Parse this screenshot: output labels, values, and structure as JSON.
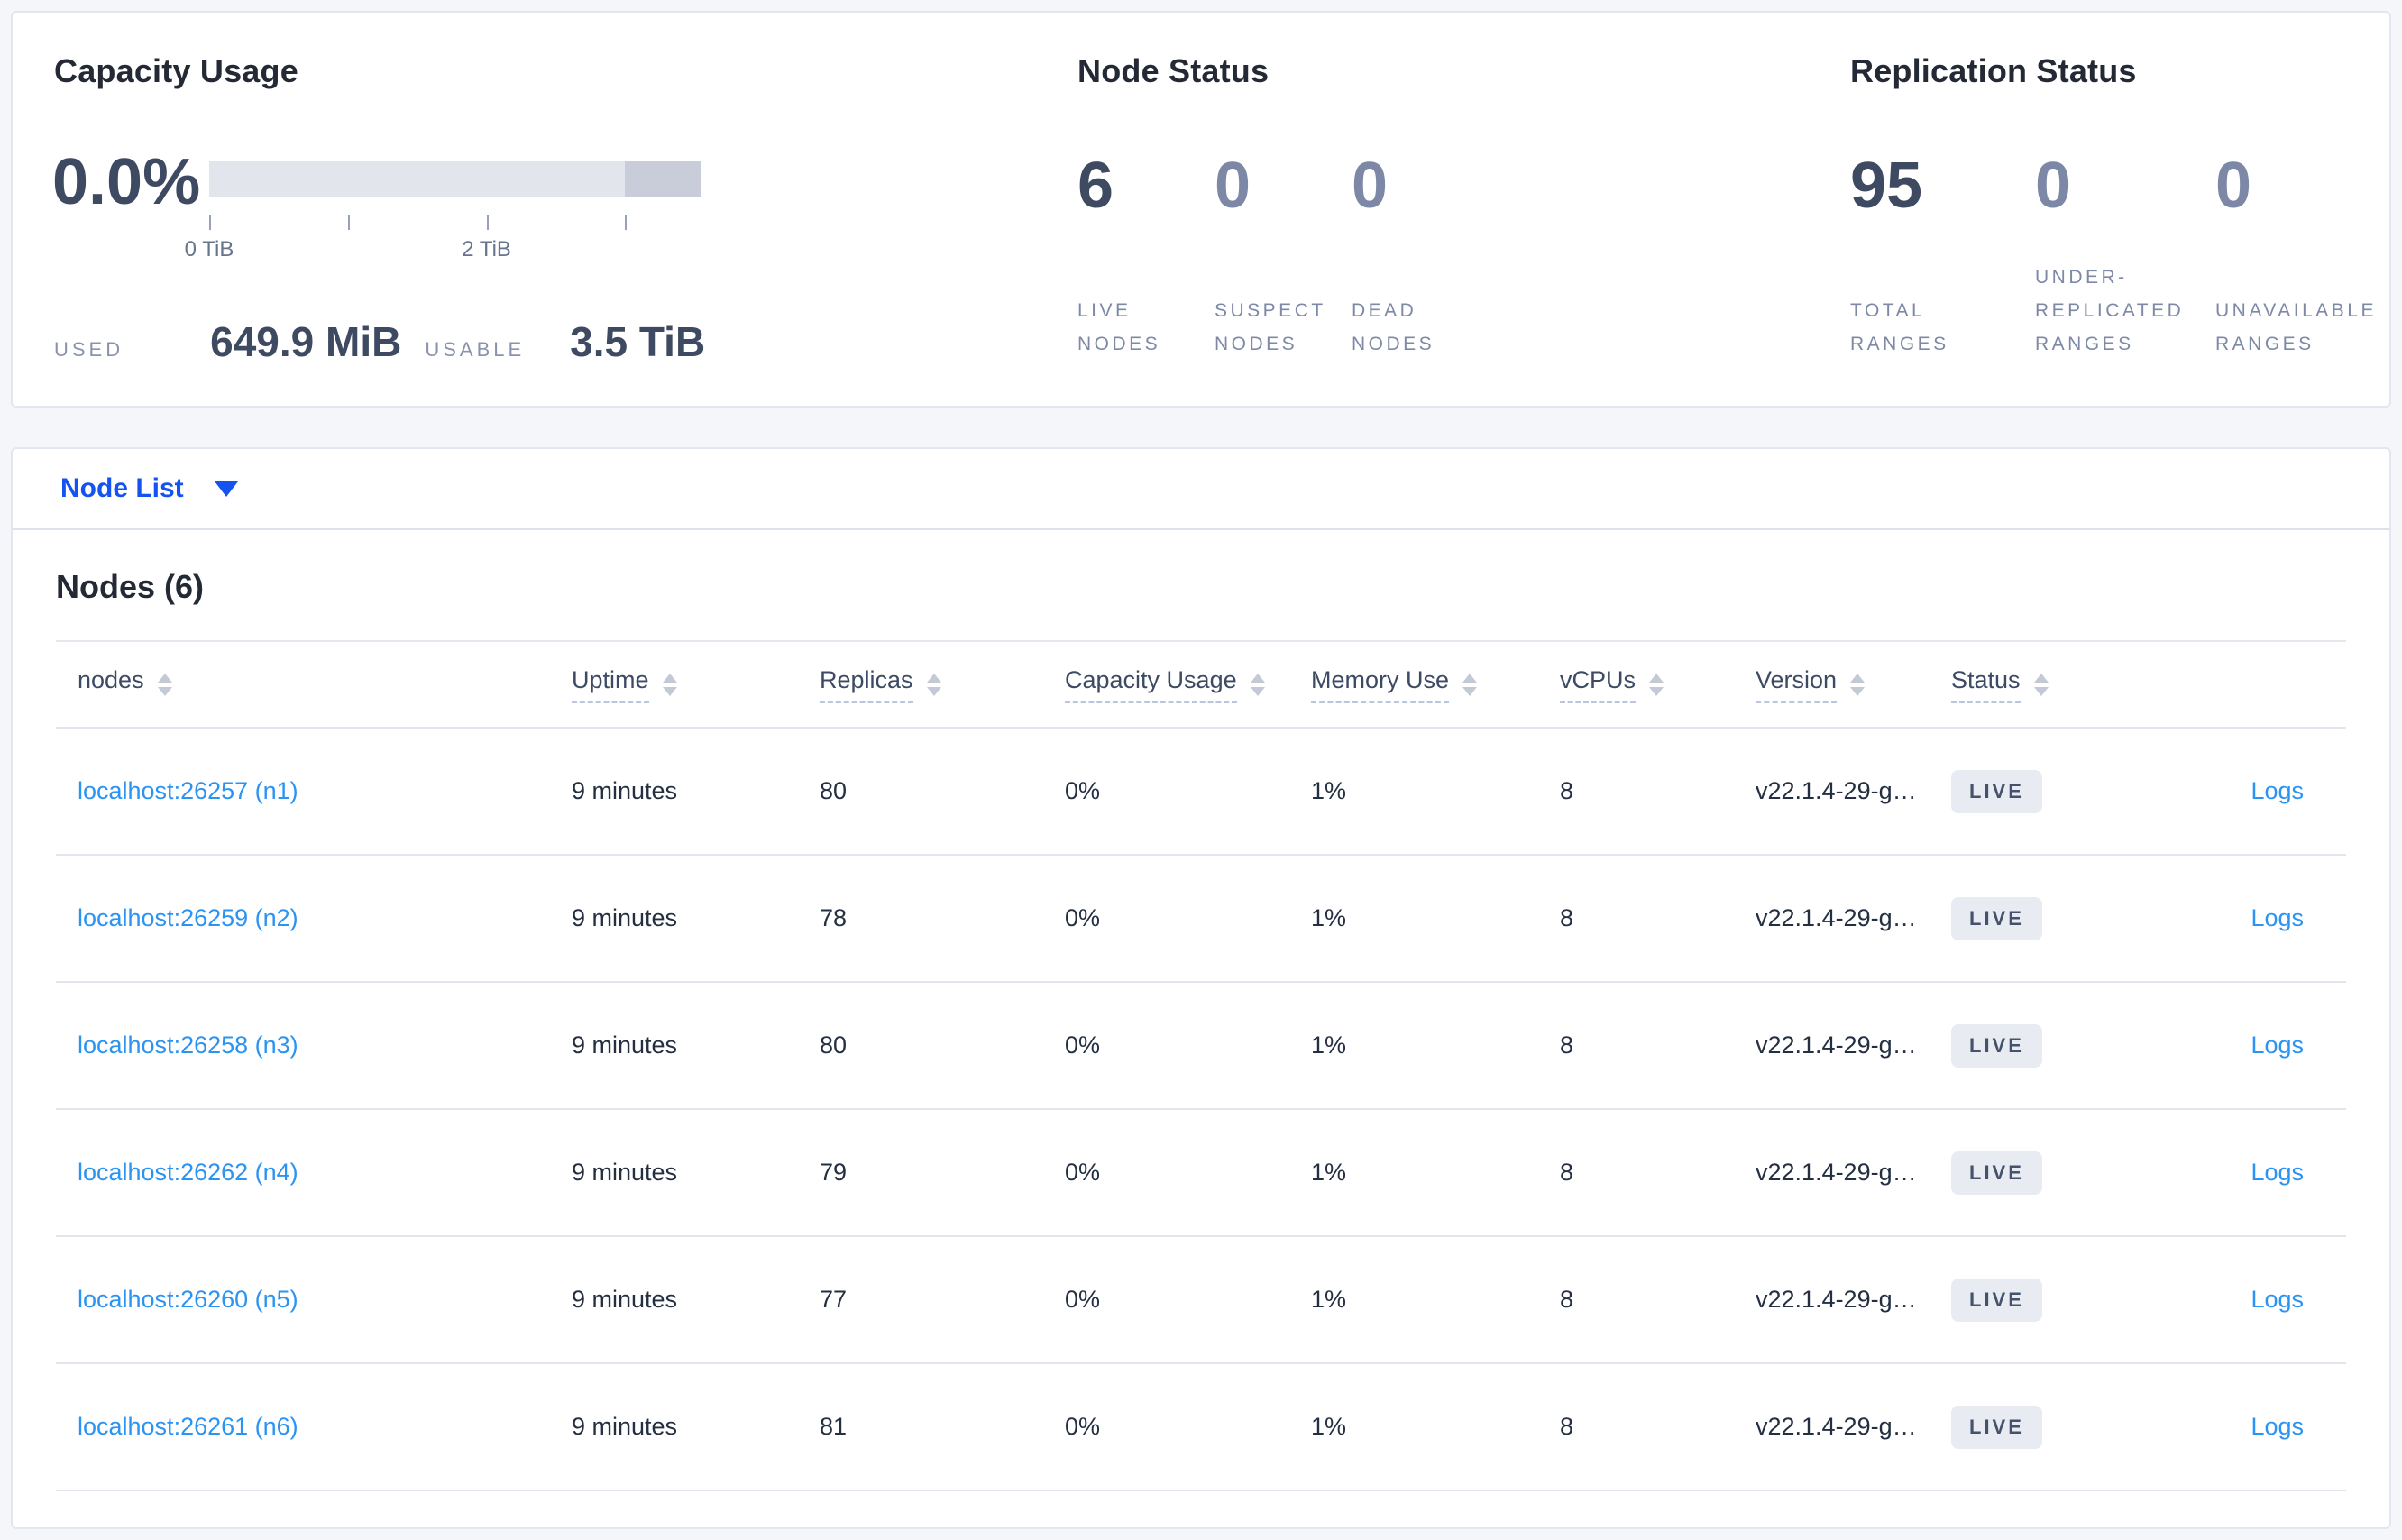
{
  "colors": {
    "selector_blue": "#1553f0",
    "link_blue": "#2b93f2",
    "badge_bg": "#e8ecf2",
    "badge_text": "#44526b",
    "bar_track": "#e3e5ec",
    "bar_highlight": "#c9cdd9"
  },
  "summary": {
    "capacity": {
      "title": "Capacity Usage",
      "percent": "0.0%",
      "used_label": "USED",
      "used_value": "649.9 MiB",
      "usable_label": "USABLE",
      "usable_value": "3.5 TiB",
      "axis_tick_labels": [
        "0 TiB",
        "2 TiB"
      ],
      "bar": {
        "extent_tib": 3.55,
        "tick_values_tib": [
          0,
          1,
          2,
          3
        ],
        "labeled_tick_values_tib": [
          0,
          2
        ],
        "used_fraction": 0.0,
        "highlight_from_tib": 3.0
      }
    },
    "node_status": {
      "title": "Node Status",
      "stats": [
        {
          "value": "6",
          "label": "LIVE NODES"
        },
        {
          "value": "0",
          "label": "SUSPECT NODES"
        },
        {
          "value": "0",
          "label": "DEAD NODES"
        }
      ]
    },
    "replication_status": {
      "title": "Replication Status",
      "stats": [
        {
          "value": "95",
          "label": "TOTAL RANGES"
        },
        {
          "value": "0",
          "label": "UNDER-REPLICATED RANGES"
        },
        {
          "value": "0",
          "label": "UNAVAILABLE RANGES"
        }
      ]
    }
  },
  "view_selector": {
    "label": "Node List",
    "icon": "caret-down-icon"
  },
  "nodes_table": {
    "title": "Nodes (6)",
    "columns": [
      {
        "label": "nodes",
        "sortable": true,
        "tooltip_underline": false
      },
      {
        "label": "Uptime",
        "sortable": true,
        "tooltip_underline": true
      },
      {
        "label": "Replicas",
        "sortable": true,
        "tooltip_underline": true
      },
      {
        "label": "Capacity Usage",
        "sortable": true,
        "tooltip_underline": true
      },
      {
        "label": "Memory Use",
        "sortable": true,
        "tooltip_underline": true
      },
      {
        "label": "vCPUs",
        "sortable": true,
        "tooltip_underline": true
      },
      {
        "label": "Version",
        "sortable": true,
        "tooltip_underline": true
      },
      {
        "label": "Status",
        "sortable": true,
        "tooltip_underline": true
      },
      {
        "label": "",
        "sortable": false,
        "tooltip_underline": false
      }
    ],
    "rows": [
      {
        "host": "localhost:26257 (n1)",
        "uptime": "9 minutes",
        "replicas": "80",
        "capacity_usage": "0%",
        "memory_use": "1%",
        "vcpus": "8",
        "version": "v22.1.4-29-g…",
        "status": "LIVE",
        "logs_label": "Logs"
      },
      {
        "host": "localhost:26259 (n2)",
        "uptime": "9 minutes",
        "replicas": "78",
        "capacity_usage": "0%",
        "memory_use": "1%",
        "vcpus": "8",
        "version": "v22.1.4-29-g…",
        "status": "LIVE",
        "logs_label": "Logs"
      },
      {
        "host": "localhost:26258 (n3)",
        "uptime": "9 minutes",
        "replicas": "80",
        "capacity_usage": "0%",
        "memory_use": "1%",
        "vcpus": "8",
        "version": "v22.1.4-29-g…",
        "status": "LIVE",
        "logs_label": "Logs"
      },
      {
        "host": "localhost:26262 (n4)",
        "uptime": "9 minutes",
        "replicas": "79",
        "capacity_usage": "0%",
        "memory_use": "1%",
        "vcpus": "8",
        "version": "v22.1.4-29-g…",
        "status": "LIVE",
        "logs_label": "Logs"
      },
      {
        "host": "localhost:26260 (n5)",
        "uptime": "9 minutes",
        "replicas": "77",
        "capacity_usage": "0%",
        "memory_use": "1%",
        "vcpus": "8",
        "version": "v22.1.4-29-g…",
        "status": "LIVE",
        "logs_label": "Logs"
      },
      {
        "host": "localhost:26261 (n6)",
        "uptime": "9 minutes",
        "replicas": "81",
        "capacity_usage": "0%",
        "memory_use": "1%",
        "vcpus": "8",
        "version": "v22.1.4-29-g…",
        "status": "LIVE",
        "logs_label": "Logs"
      }
    ]
  }
}
